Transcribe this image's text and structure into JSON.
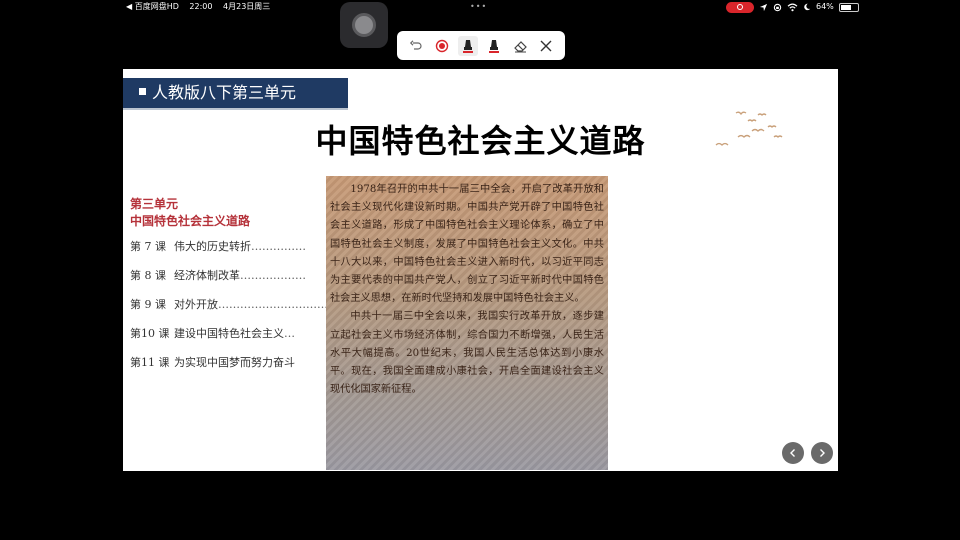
{
  "status_bar": {
    "app": "◀ 百度网盘HD",
    "time": "22:00",
    "date": "4月23日周三",
    "battery": "64%",
    "battery_level": 0.64
  },
  "toolbar": {
    "tools": [
      "undo-icon",
      "record-icon",
      "pen-icon",
      "highlighter-icon",
      "eraser-icon",
      "close-icon"
    ]
  },
  "slide": {
    "banner": "人教版八下第三单元",
    "title": "中国特色社会主义道路",
    "toc": {
      "unit_label": "第三单元",
      "unit_title": "中国特色社会主义道路",
      "items": [
        {
          "no": "第 7 课",
          "title": "伟大的历史转折",
          "dots": "……………"
        },
        {
          "no": "第 8 课",
          "title": "经济体制改革",
          "dots": "………………"
        },
        {
          "no": "第 9 课",
          "title": "对外开放",
          "dots": "…………………………"
        },
        {
          "no": "第10 课",
          "title": "建设中国特色社会主义",
          "dots": "…"
        },
        {
          "no": "第11 课",
          "title": "为实现中国梦而努力奋斗",
          "dots": ""
        }
      ]
    },
    "page_text": {
      "p1": "1978年召开的中共十一届三中全会，开启了改革开放和社会主义现代化建设新时期。中国共产党开辟了中国特色社会主义道路，形成了中国特色社会主义理论体系，确立了中国特色社会主义制度，发展了中国特色社会主义文化。中共十八大以来，中国特色社会主义进入新时代，以习近平同志为主要代表的中国共产党人，创立了习近平新时代中国特色社会主义思想，在新时代坚持和发展中国特色社会主义。",
      "p2": "中共十一届三中全会以来，我国实行改革开放，逐步建立起社会主义市场经济体制，综合国力不断增强，人民生活水平大幅提高。20世纪末，我国人民生活总体达到小康水平。现在，我国全面建成小康社会，开启全面建设社会主义现代化国家新征程。"
    },
    "nav": {
      "prev": "‹",
      "next": "›"
    }
  },
  "colors": {
    "banner": "#1f3a63",
    "unit_red": "#b5323a",
    "record_red": "#d9252b"
  }
}
